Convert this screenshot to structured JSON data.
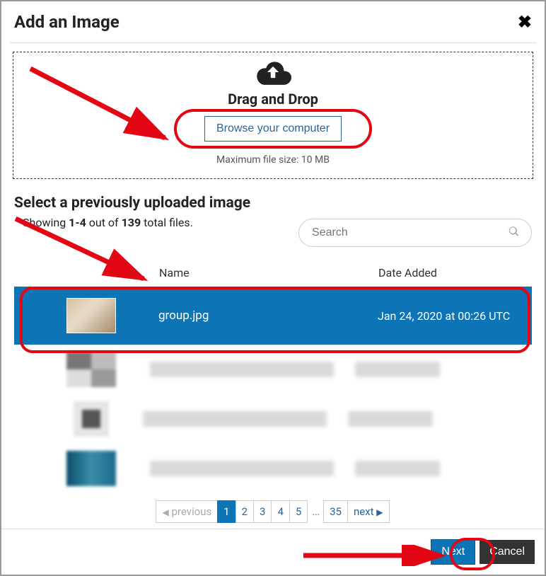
{
  "modal": {
    "title": "Add an Image"
  },
  "dropzone": {
    "heading": "Drag and Drop",
    "browse_label": "Browse your computer",
    "max_size_text": "Maximum file size: 10 MB"
  },
  "previous": {
    "title": "Select a previously uploaded image",
    "showing_prefix": "Showing ",
    "range": "1-4",
    "out_of": " out of ",
    "total": "139",
    "total_suffix": " total files."
  },
  "search": {
    "placeholder": "Search"
  },
  "columns": {
    "name": "Name",
    "date": "Date Added"
  },
  "files": {
    "selected": {
      "name": "group.jpg",
      "date": "Jan 24, 2020 at 00:26 UTC"
    }
  },
  "pagination": {
    "prev": "previous",
    "next": "next",
    "pages": [
      "1",
      "2",
      "3",
      "4",
      "5"
    ],
    "last": "35"
  },
  "footer": {
    "next": "Next",
    "cancel": "Cancel"
  }
}
